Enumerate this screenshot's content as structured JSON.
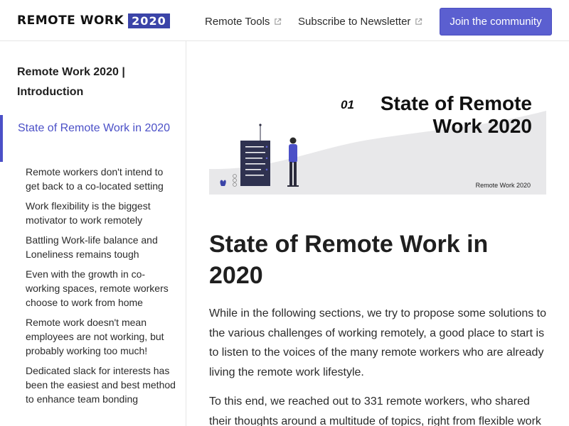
{
  "header": {
    "logo_main": "REMOTE WORK",
    "logo_year": "2020",
    "nav": [
      {
        "label": "Remote Tools",
        "icon": "external-link-icon"
      },
      {
        "label": "Subscribe to Newsletter",
        "icon": "external-link-icon"
      }
    ],
    "cta_label": "Join the community"
  },
  "sidebar": {
    "title": "Remote Work 2020 | Introduction",
    "active_label": "State of Remote Work in 2020",
    "items": [
      "Remote workers don't intend to get back to a co-located setting",
      "Work flexibility is the biggest motivator to work remotely",
      "Battling Work-life balance and Loneliness remains tough",
      "Even with the growth in co-working spaces, remote workers choose to work from home",
      "Remote work doesn't mean employees are not working, but probably working too much!",
      "Dedicated slack for interests has been the easiest and best method to enhance team bonding"
    ]
  },
  "banner": {
    "number": "01",
    "title_line1": "State of Remote",
    "title_line2": "Work 2020",
    "footer": "Remote Work 2020"
  },
  "main": {
    "title": "State of Remote Work in 2020",
    "paragraphs": [
      "While in the following sections, we try to propose some solutions to the various challenges of working remotely, a good place to start is to listen to the voices of the many remote workers who are already living the remote work lifestyle.",
      "To this end, we reached out to 331 remote workers, who shared their thoughts around a multitude of topics, right from flexible work"
    ]
  },
  "colors": {
    "accent": "#4b50c7",
    "button": "#5b5fd0",
    "logo_badge": "#3b44a8"
  }
}
